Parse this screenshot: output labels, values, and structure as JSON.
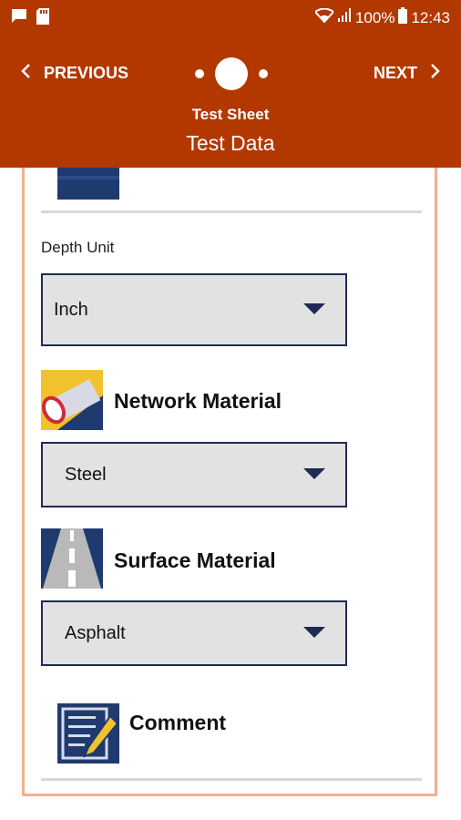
{
  "status": {
    "battery": "100%",
    "time": "12:43"
  },
  "nav": {
    "previous_label": "PREVIOUS",
    "next_label": "NEXT"
  },
  "header": {
    "subtitle": "Test Sheet",
    "title": "Test Data"
  },
  "form": {
    "depth_unit": {
      "label": "Depth Unit",
      "value": "Inch"
    },
    "network_material": {
      "title": "Network Material",
      "value": "Steel"
    },
    "surface_material": {
      "title": "Surface Material",
      "value": "Asphalt"
    },
    "comment": {
      "title": "Comment"
    }
  },
  "colors": {
    "header": "#b23800",
    "card_border": "#f2b08c",
    "select_border": "#1f2a55",
    "select_bg": "#e2e2e2"
  }
}
